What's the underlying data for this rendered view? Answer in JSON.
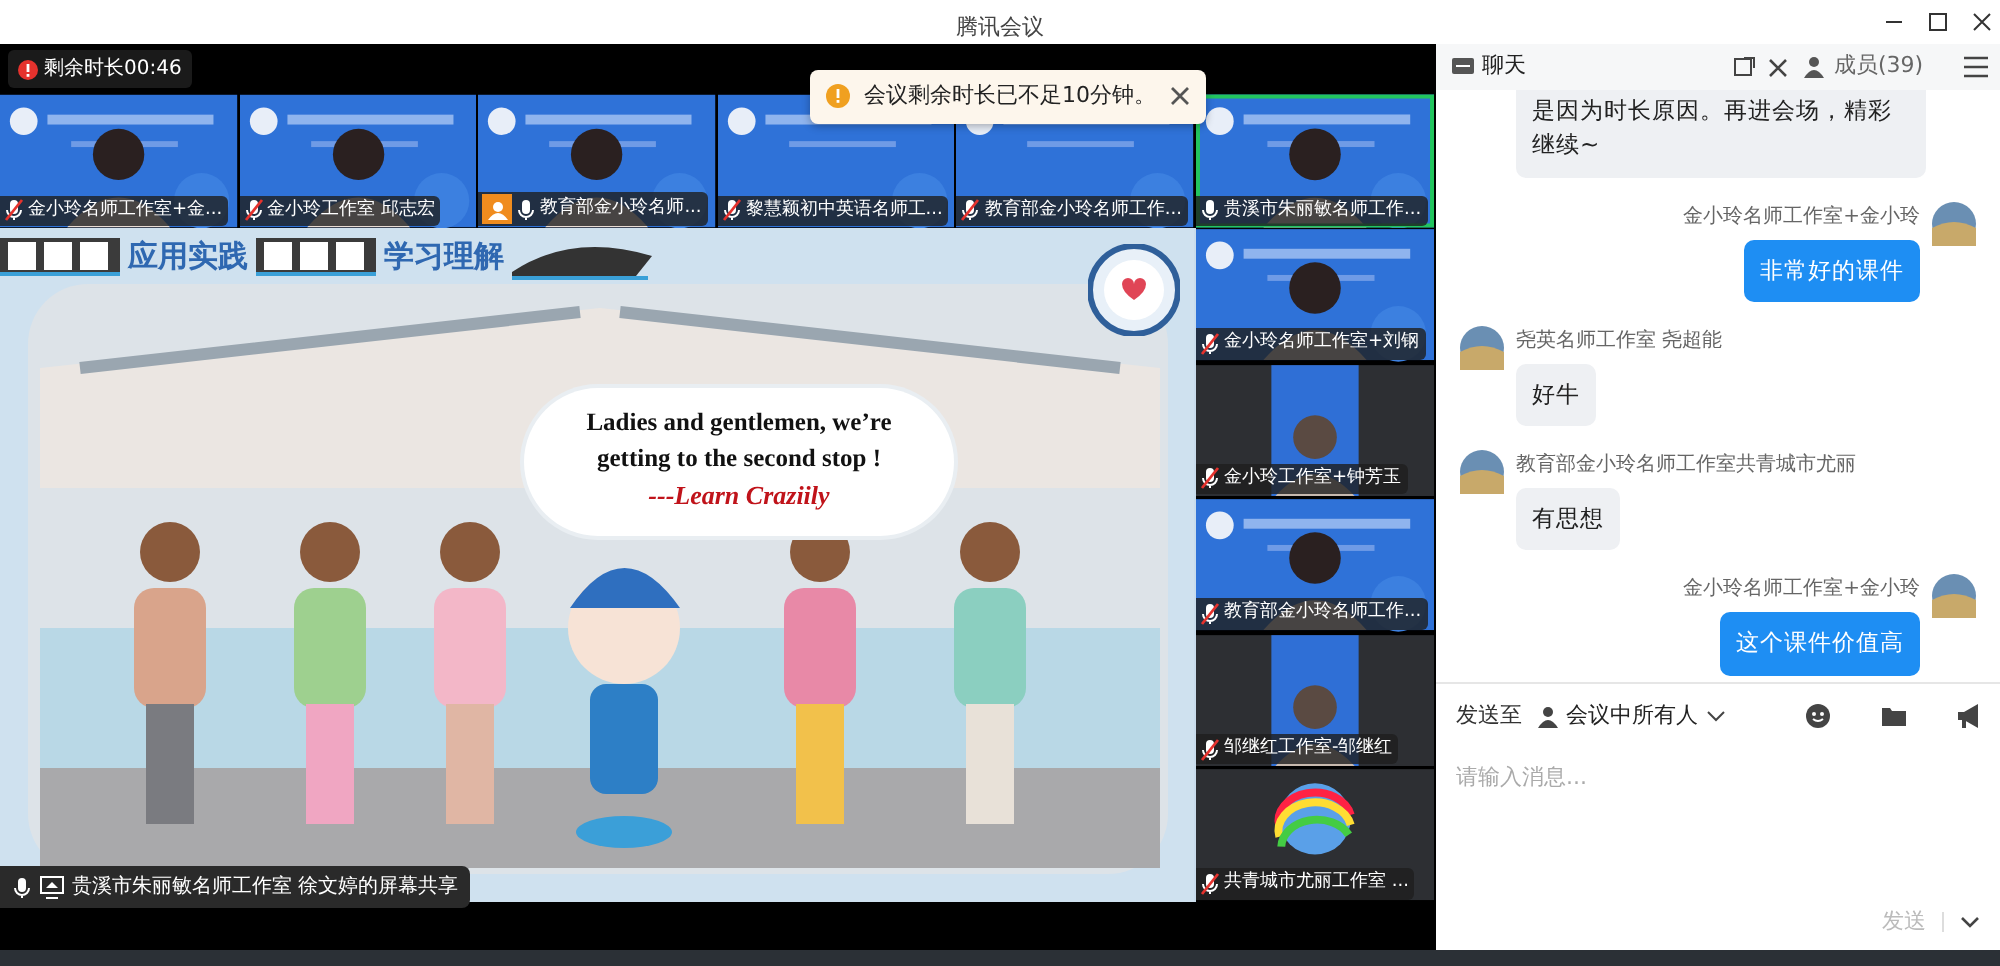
{
  "window": {
    "title": "腾讯会议"
  },
  "timer": {
    "text": "剩余时长00:46"
  },
  "toast": {
    "text": "会议剩余时长已不足10分钟。"
  },
  "top_tiles": [
    {
      "name": "金小玲名师工作室+金...",
      "muted": true,
      "selected": false,
      "kind": "video"
    },
    {
      "name": "金小玲工作室  邱志宏",
      "muted": true,
      "selected": false,
      "kind": "video"
    },
    {
      "name": "教育部金小玲名师...",
      "muted": false,
      "selected": false,
      "kind": "avatar-video"
    },
    {
      "name": "黎慧颖初中英语名师工...",
      "muted": true,
      "selected": false,
      "kind": "slide"
    },
    {
      "name": "教育部金小玲名师工作...",
      "muted": true,
      "selected": false,
      "kind": "slide"
    },
    {
      "name": "贵溪市朱丽敏名师工作...",
      "muted": false,
      "selected": true,
      "kind": "video"
    }
  ],
  "side_tiles": [
    {
      "name": "金小玲名师工作室+刘钢",
      "muted": true,
      "kind": "video"
    },
    {
      "name": "金小玲工作室+钟芳玉",
      "muted": true,
      "kind": "narrow"
    },
    {
      "name": "教育部金小玲名师工作...",
      "muted": true,
      "kind": "video"
    },
    {
      "name": "邹继红工作室-邹继红",
      "muted": true,
      "kind": "narrow"
    },
    {
      "name": "共青城市尤丽工作室 ...",
      "muted": true,
      "kind": "rainbow"
    }
  ],
  "slide": {
    "banner": [
      "应用实践",
      "学习理解"
    ],
    "bubble": "Ladies and gentlemen, we’re getting to the second stop !",
    "signature": "---Learn Craziily"
  },
  "share_label": "贵溪市朱丽敏名师工作室  徐文婷的屏幕共享",
  "chat": {
    "tabs": [
      {
        "label": "聊天",
        "selected": true
      },
      {
        "label": "成员(39)",
        "selected": false
      }
    ],
    "messages": [
      {
        "kind": "in",
        "text": "是因为时长原因。再进会场，精彩继续~"
      },
      {
        "kind": "out",
        "sender": "金小玲名师工作室+金小玲",
        "text": "非常好的课件"
      },
      {
        "kind": "in",
        "sender": "尧英名师工作室 尧超能",
        "text": "好牛"
      },
      {
        "kind": "in",
        "sender": "教育部金小玲名师工作室共青城市尤丽",
        "text": "有思想"
      },
      {
        "kind": "out",
        "sender": "金小玲名师工作室+金小玲",
        "text": "这个课件价值高"
      }
    ],
    "send_to_label": "发送至",
    "recipient": "会议中所有人",
    "placeholder": "请输入消息...",
    "send": {
      "label": "发送",
      "disabled": true
    }
  }
}
